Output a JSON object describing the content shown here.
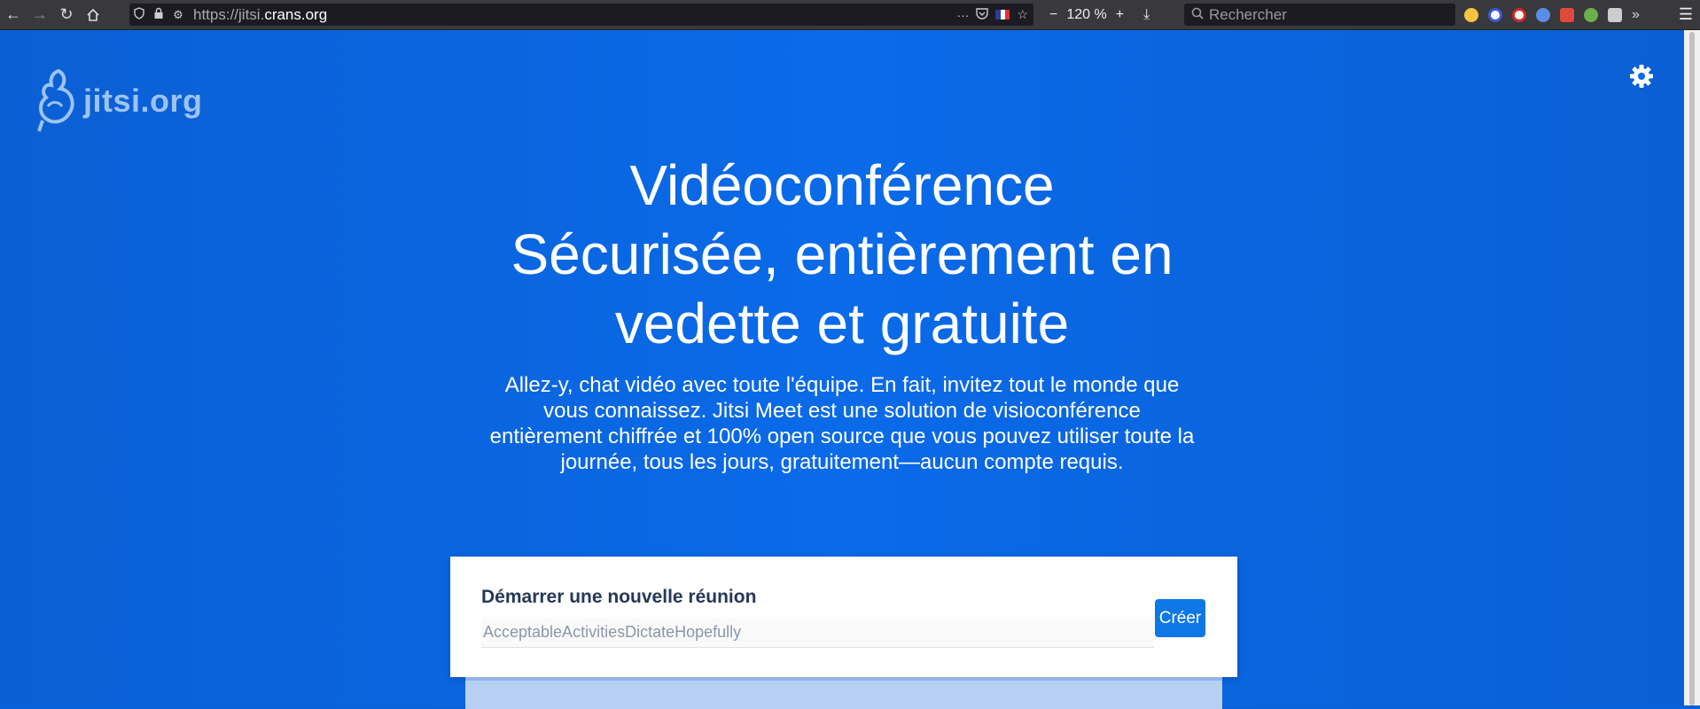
{
  "browser": {
    "url_protocol": "https://jitsi.",
    "url_domain": "crans.org",
    "zoom": "120 %",
    "search_placeholder": "Rechercher",
    "url_more": "···"
  },
  "page": {
    "logo_text": "jitsi.org",
    "title_line1": "Vidéoconférence",
    "title_line2": "Sécurisée, entièrement en",
    "title_line3": "vedette et gratuite",
    "description": "Allez-y, chat vidéo avec toute l'équipe. En fait, invitez tout le monde que vous connaissez. Jitsi Meet est une solution de visioconférence entièrement chiffrée et 100% open source que vous pouvez utiliser toute la journée, tous les jours, gratuitement—aucun compte requis.",
    "card_title": "Démarrer une nouvelle réunion",
    "room_name_value": "AcceptableActivitiesDictateHopefully",
    "create_button": "Créer"
  },
  "colors": {
    "background": "#0a61d9",
    "button": "#0f78e6",
    "logo": "#9cc3f2"
  }
}
